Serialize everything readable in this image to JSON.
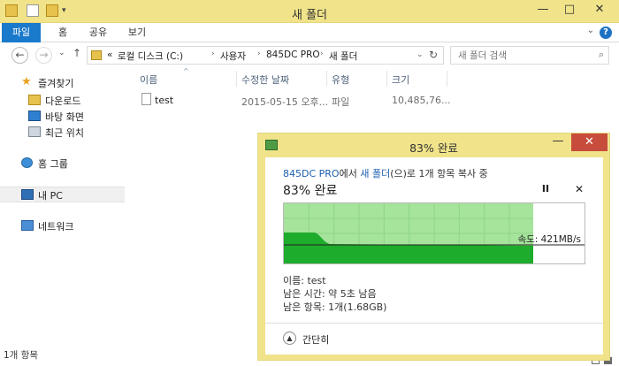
{
  "window": {
    "title": "새 폴더",
    "minimize": "—",
    "maximize": "□",
    "close": "✕"
  },
  "ribbon": {
    "tabs": [
      "파일",
      "홈",
      "공유",
      "보기"
    ],
    "help": "?",
    "collapse": "⌄"
  },
  "address": {
    "prefix": "«",
    "path": [
      "로컬 디스크 (C:)",
      "사용자",
      "845DC PRO",
      "새 폴더"
    ],
    "search_placeholder": "새 폴더 검색"
  },
  "nav": {
    "back": "←",
    "forward": "→",
    "recent": "⌄",
    "up": "↑",
    "refresh": "↻",
    "dropdown": "⌄",
    "favorites": "즐겨찾기",
    "downloads": "다운로드",
    "desktop": "바탕 화면",
    "recent_places": "최근 위치",
    "homegroup": "홈 그룹",
    "this_pc": "내 PC",
    "network": "네트워크"
  },
  "columns": {
    "name": "이름",
    "modified": "수정한 날짜",
    "type": "유형",
    "size": "크기"
  },
  "files": [
    {
      "name": "test",
      "modified": "2015-05-15 오후...",
      "type": "파일",
      "size": "10,485,76..."
    }
  ],
  "status": {
    "count": "1개 항목"
  },
  "copy_dialog": {
    "title": "83% 완료",
    "minimize": "—",
    "close": "✕",
    "source": "845DC PRO",
    "text_from": "에서 ",
    "destination": "새 폴더",
    "text_rest": "(으)로 1개 항목 복사 중",
    "heading": "83% 완료",
    "pause": "II",
    "cancel": "✕",
    "speed": "속도: 421MB/s",
    "name_line": "이름: test",
    "time_left": "남은 시간: 약 5초 남음",
    "items_left": "남은 항목: 1개(1.68GB)",
    "less_details": "간단히",
    "less_icon": "▲",
    "progress": 0.83,
    "colors": {
      "fill_light": "#a6e39b",
      "fill_dark": "#1dac2b",
      "grid": "#8fd585",
      "speed_line": "#222222"
    }
  }
}
